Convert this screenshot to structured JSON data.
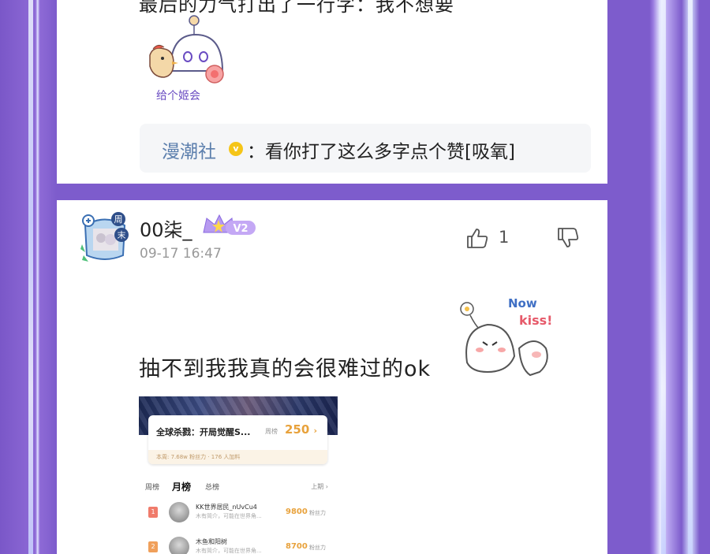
{
  "top_comment": {
    "partial_text": "最后的力气打出了一行字：我不想要",
    "sticker_text": "给个姬会",
    "reply": {
      "author": "漫潮社",
      "badge_symbol": "v",
      "text": "：看你打了这么多字点个赞[吸氧]"
    }
  },
  "comment": {
    "avatar_badges": [
      "周",
      "末"
    ],
    "username": "00柒_",
    "level": "V2",
    "timestamp": "09-17 16:47",
    "like_count": "1",
    "text": "抽不到我我真的会很难过的ok",
    "sticker_text": [
      "Now",
      "kiss!"
    ]
  },
  "screenshot": {
    "title": "全球杀戮：开局觉醒S...",
    "rank_label": "周榜",
    "rank_value": "250",
    "rank_arrow": "›",
    "sub_stats": "本周: 7.68w 粉丝力 · 176 人加料",
    "tabs": [
      "周榜",
      "月榜",
      "总榜"
    ],
    "more": "上期 ›",
    "rows": [
      {
        "rank": "1",
        "name": "KK世界居民_nUvCu4",
        "desc": "木有简介，可能在世界角...",
        "score": "9800",
        "unit": "粉丝力"
      },
      {
        "rank": "2",
        "name": "木鱼和阳树",
        "desc": "木有简介，可能在世界角...",
        "score": "8700",
        "unit": "粉丝力"
      }
    ]
  },
  "colors": {
    "accent_purple": "#7d5ccc",
    "reply_name": "#5c7fad",
    "rank_gold": "#e8a23c",
    "rank1_badge": "#f07b6b",
    "rank2_badge": "#f0a05b"
  }
}
